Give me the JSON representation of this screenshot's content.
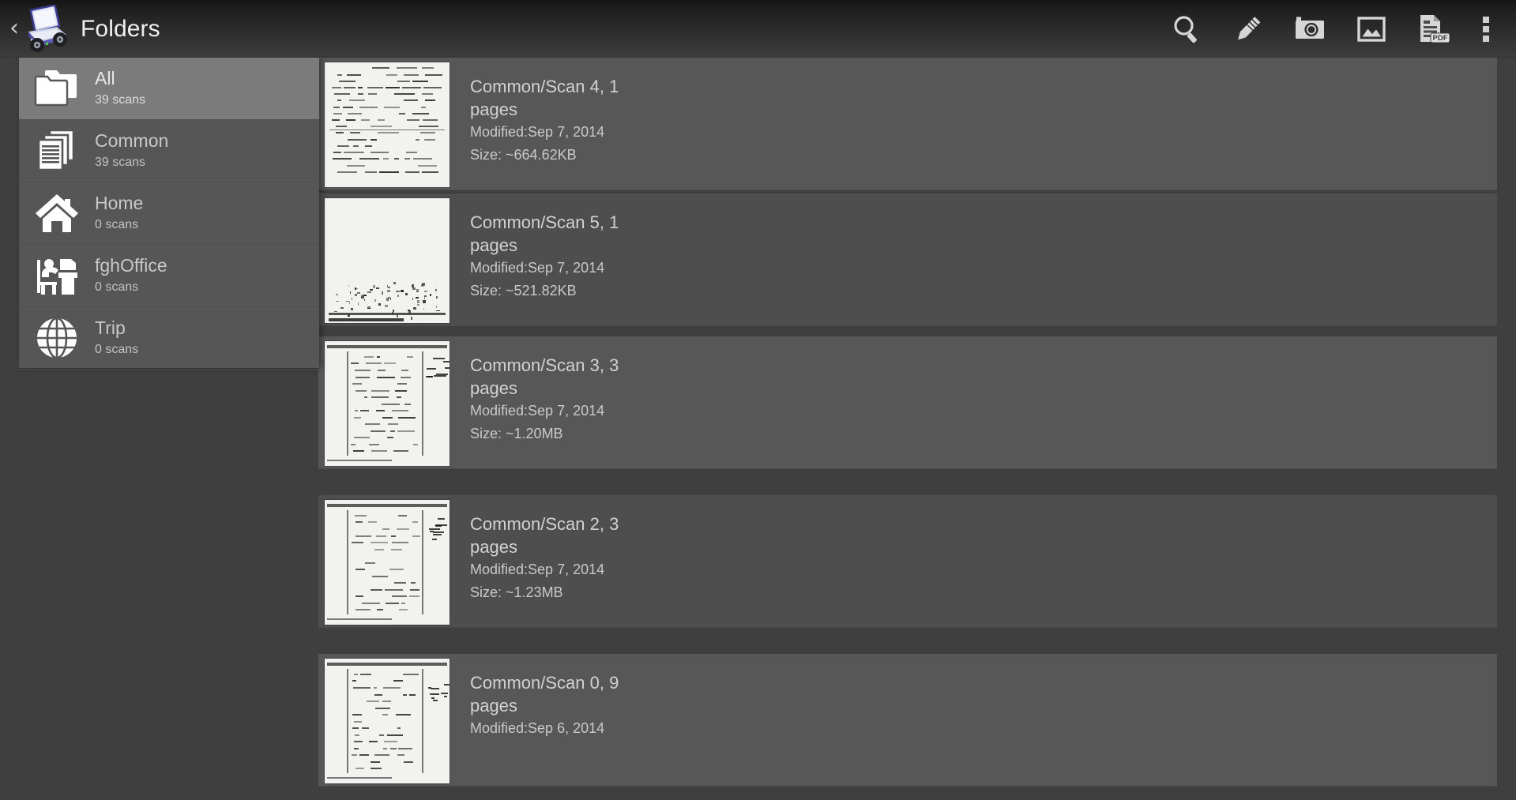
{
  "app": {
    "title": "Folders",
    "logo_icon": "scanner-on-wheels-icon",
    "back_icon": "back-chevron-icon"
  },
  "colors": {
    "actionbar_top": "#141414",
    "actionbar_bottom": "#3c3c3c",
    "drawer_bg": "#565656",
    "drawer_selected": "#7b7b7b",
    "row_bg": "#575757",
    "row_bg_alt": "#4e4e4e",
    "page_bg": "#3f3f3f",
    "text_primary": "#e9e9e9",
    "text_secondary": "#c9c9c9"
  },
  "toolbar": {
    "actions": [
      {
        "name": "search-button",
        "icon": "search-icon",
        "label": "Search"
      },
      {
        "name": "edit-button",
        "icon": "pencil-icon",
        "label": "Edit"
      },
      {
        "name": "camera-button",
        "icon": "camera-icon",
        "label": "Camera"
      },
      {
        "name": "gallery-button",
        "icon": "image-icon",
        "label": "Gallery"
      },
      {
        "name": "pdf-button",
        "icon": "pdf-file-icon",
        "label": "PDF"
      },
      {
        "name": "overflow-button",
        "icon": "more-vert-icon",
        "label": "More options"
      }
    ]
  },
  "sidebar": {
    "items": [
      {
        "label": "All",
        "count": "39 scans",
        "icon": "folders-icon",
        "selected": true
      },
      {
        "label": "Common",
        "count": "39 scans",
        "icon": "documents-icon",
        "selected": false
      },
      {
        "label": "Home",
        "count": "0 scans",
        "icon": "home-icon",
        "selected": false
      },
      {
        "label": "fghOffice",
        "count": "0 scans",
        "icon": "office-icon",
        "selected": false
      },
      {
        "label": "Trip",
        "count": "0 scans",
        "icon": "globe-icon",
        "selected": false
      }
    ]
  },
  "scan_list": {
    "items": [
      {
        "title": "Common/Scan 4, 1 pages",
        "modified": "Modified:Sep 7, 2014",
        "size": "Size: ~664.62KB",
        "thumbnail": "scanned-text-page-thumbnail"
      },
      {
        "title": "Common/Scan 5, 1 pages",
        "modified": "Modified:Sep 7, 2014",
        "size": "Size: ~521.82KB",
        "thumbnail": "scanned-blank-page-thumbnail"
      },
      {
        "title": "Common/Scan 3, 3 pages",
        "modified": "Modified:Sep 7, 2014",
        "size": "Size: ~1.20MB",
        "thumbnail": "scanned-form-page-thumbnail"
      },
      {
        "title": "Common/Scan 2, 3 pages",
        "modified": "Modified:Sep 7, 2014",
        "size": "Size: ~1.23MB",
        "thumbnail": "scanned-form-page-thumbnail"
      },
      {
        "title": "Common/Scan 0, 9 pages",
        "modified": "Modified:Sep 6, 2014",
        "size": "",
        "thumbnail": "scanned-form-page-thumbnail"
      }
    ]
  }
}
